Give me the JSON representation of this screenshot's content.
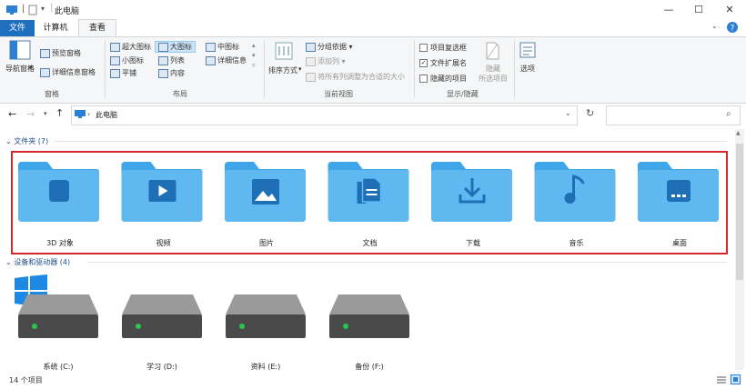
{
  "window": {
    "title": "此电脑",
    "minimize": "—",
    "maximize": "☐",
    "close": "✕"
  },
  "ribbon_tabs": [
    "文件",
    "计算机",
    "查看"
  ],
  "ribbon": {
    "panes": {
      "nav_pane": "导航窗格",
      "preview_pane": "预览窗格",
      "details_pane": "详细信息窗格",
      "group_label": "窗格"
    },
    "layout": {
      "extra_large": "超大图标",
      "large": "大图标",
      "medium": "中图标",
      "small": "小图标",
      "list": "列表",
      "details": "详细信息",
      "tiles": "平铺",
      "content": "内容",
      "group_label": "布局"
    },
    "current_view": {
      "sort_by": "排序方式",
      "group_by": "分组依据",
      "add_column": "添加列",
      "fit_columns": "将所有列调整为合适的大小",
      "group_label": "当前视图"
    },
    "show_hide": {
      "item_checkboxes": "项目复选框",
      "file_extensions": "文件扩展名",
      "hidden_items": "隐藏的项目",
      "hide_selected": "隐藏\n所选项目",
      "group_label": "显示/隐藏"
    },
    "options": "选项"
  },
  "address": {
    "path": "此电脑",
    "search_placeholder": ""
  },
  "sections": {
    "folders_header": "文件夹 (7)",
    "drives_header": "设备和驱动器 (4)"
  },
  "folders": [
    {
      "label": "3D 对象",
      "icon": "cube-icon"
    },
    {
      "label": "视频",
      "icon": "video-icon"
    },
    {
      "label": "图片",
      "icon": "picture-icon"
    },
    {
      "label": "文档",
      "icon": "document-icon"
    },
    {
      "label": "下载",
      "icon": "download-icon"
    },
    {
      "label": "音乐",
      "icon": "music-icon"
    },
    {
      "label": "桌面",
      "icon": "desktop-icon"
    }
  ],
  "drives": [
    {
      "label": "系统 (C:)"
    },
    {
      "label": "学习 (D:)"
    },
    {
      "label": "资料 (E:)"
    },
    {
      "label": "备份 (F:)"
    }
  ],
  "status": {
    "item_count": "14 个项目"
  },
  "colors": {
    "folder": "#5fb8f0",
    "folder_tab": "#3fa6ea",
    "folder_glyph": "#1e6fb5",
    "file_tab": "#1f6fbf",
    "selection_border": "#d12a2a",
    "drive_body": "#4a4a4a",
    "drive_led": "#29c74a"
  }
}
